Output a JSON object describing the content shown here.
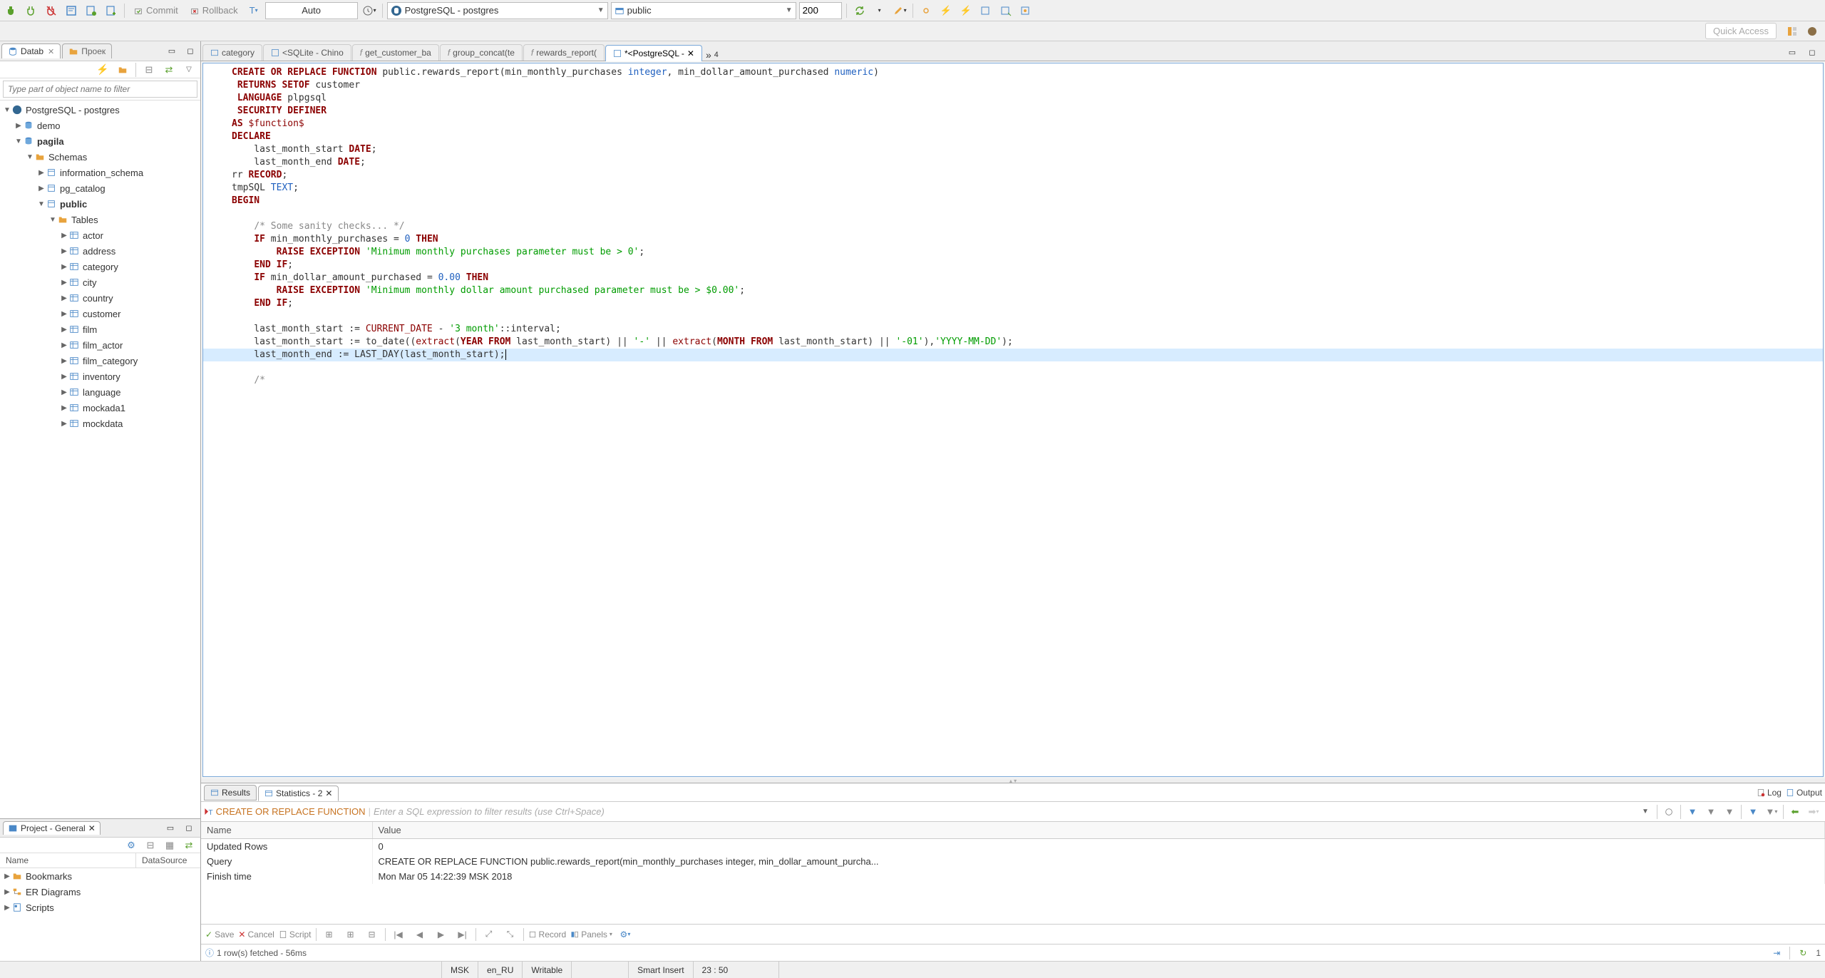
{
  "toolbar": {
    "commit": "Commit",
    "rollback": "Rollback",
    "auto": "Auto",
    "db_combo": "PostgreSQL - postgres",
    "schema_combo": "public",
    "limit": "200",
    "quick_access": "Quick Access"
  },
  "nav_panel": {
    "tab_datab": "Datab",
    "tab_proek": "Проек",
    "filter_placeholder": "Type part of object name to filter",
    "tree": {
      "root": "PostgreSQL - postgres",
      "db_demo": "demo",
      "db_pagila": "pagila",
      "schemas": "Schemas",
      "s_info": "information_schema",
      "s_pgcat": "pg_catalog",
      "s_public": "public",
      "tables": "Tables",
      "t_actor": "actor",
      "t_address": "address",
      "t_category": "category",
      "t_city": "city",
      "t_country": "country",
      "t_customer": "customer",
      "t_film": "film",
      "t_film_actor": "film_actor",
      "t_film_category": "film_category",
      "t_inventory": "inventory",
      "t_language": "language",
      "t_mockada1": "mockada1",
      "t_mockdata": "mockdata"
    }
  },
  "project_panel": {
    "title": "Project - General",
    "col_name": "Name",
    "col_ds": "DataSource",
    "items": {
      "bookmarks": "Bookmarks",
      "er": "ER Diagrams",
      "scripts": "Scripts"
    }
  },
  "editor_tabs": {
    "t0": "category",
    "t1": "<SQLite - Chino",
    "t2": "get_customer_ba",
    "t3": "group_concat(te",
    "t4": "rewards_report(",
    "t5": "*<PostgreSQL -",
    "overflow": "»",
    "overflow_n": "4"
  },
  "results": {
    "tab_results": "Results",
    "tab_stats": "Statistics - 2",
    "log": "Log",
    "output": "Output",
    "filter_sql": "CREATE OR REPLACE FUNCTION",
    "filter_hint": "Enter a SQL expression to filter results (use Ctrl+Space)",
    "col_name": "Name",
    "col_value": "Value",
    "rows": [
      {
        "name": "Updated Rows",
        "value": "0"
      },
      {
        "name": "Query",
        "value": "CREATE OR REPLACE FUNCTION public.rewards_report(min_monthly_purchases integer, min_dollar_amount_purcha..."
      },
      {
        "name": "Finish time",
        "value": "Mon Mar 05 14:22:39 MSK 2018"
      }
    ],
    "tb": {
      "save": "Save",
      "cancel": "Cancel",
      "script": "Script",
      "record": "Record",
      "panels": "Panels"
    },
    "status_msg": "1 row(s) fetched - 56ms",
    "refresh_n": "1"
  },
  "statusbar": {
    "tz": "MSK",
    "locale": "en_RU",
    "writable": "Writable",
    "insert": "Smart Insert",
    "pos": "23 : 50"
  }
}
